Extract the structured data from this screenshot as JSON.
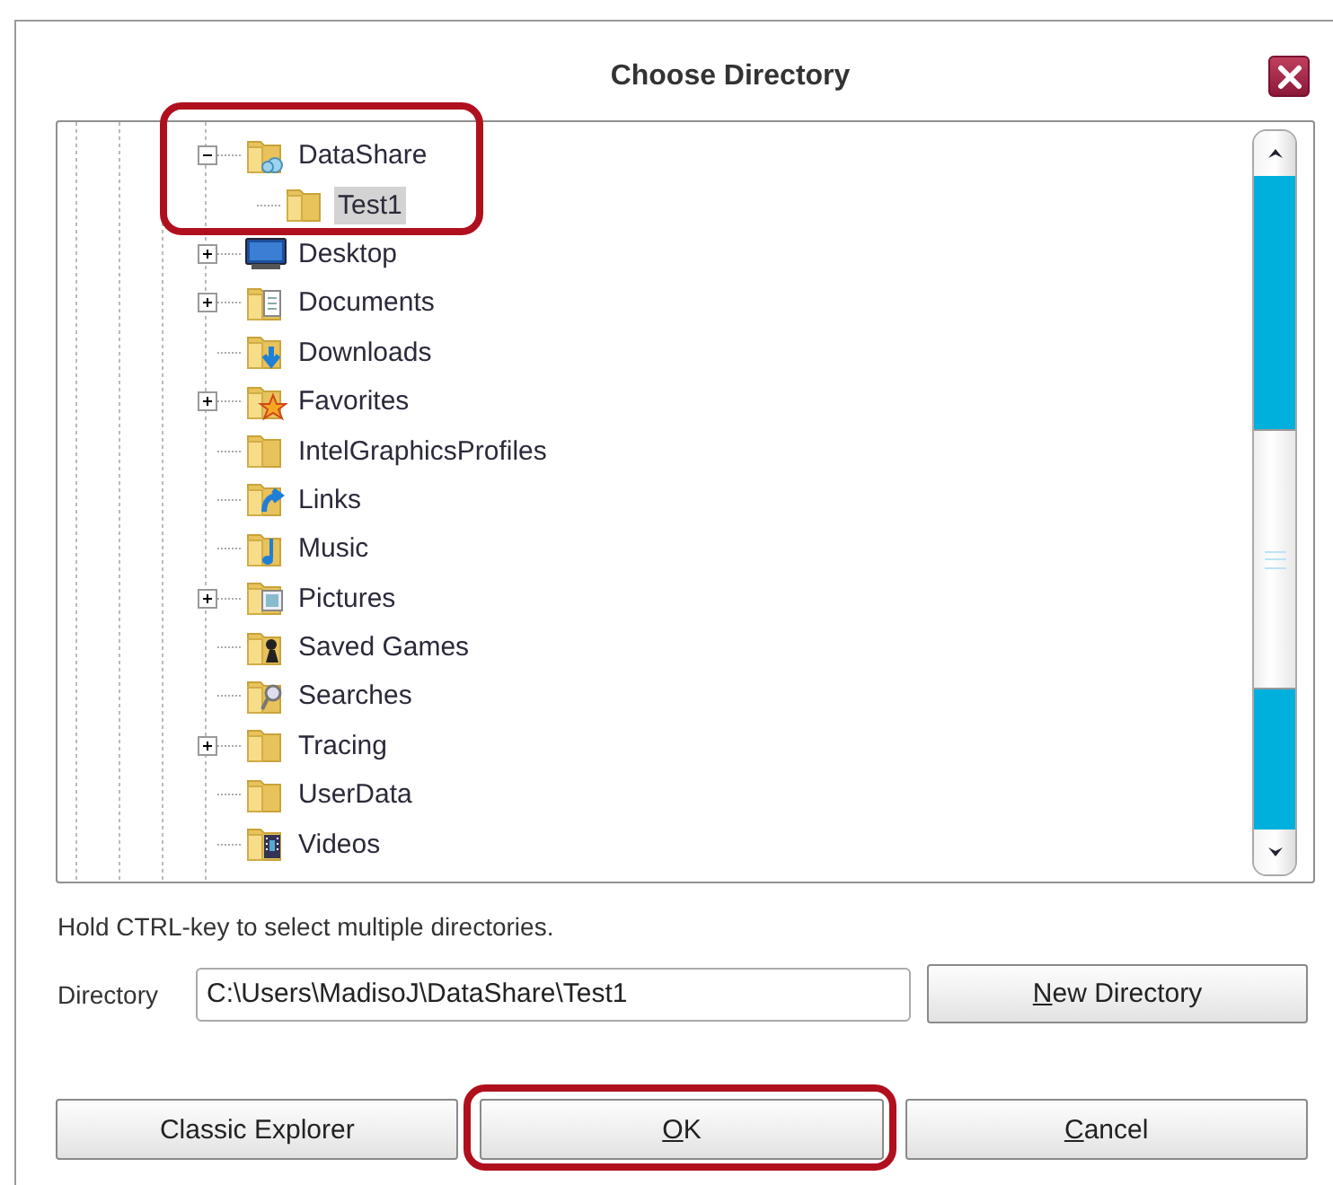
{
  "window": {
    "title": "Choose Directory"
  },
  "tree": [
    {
      "label": "DataShare",
      "kind": "cloud-folder",
      "expanded": true,
      "selected": false,
      "callout": true,
      "children": [
        {
          "label": "Test1",
          "kind": "folder",
          "selected": true
        }
      ]
    },
    {
      "label": "Desktop",
      "kind": "desktop",
      "expanded": false,
      "selected": false
    },
    {
      "label": "Documents",
      "kind": "documents",
      "expanded": false,
      "selected": false
    },
    {
      "label": "Downloads",
      "kind": "downloads",
      "selected": false
    },
    {
      "label": "Favorites",
      "kind": "favorites",
      "expanded": false,
      "selected": false
    },
    {
      "label": "IntelGraphicsProfiles",
      "kind": "folder",
      "selected": false
    },
    {
      "label": "Links",
      "kind": "links",
      "selected": false
    },
    {
      "label": "Music",
      "kind": "music",
      "selected": false
    },
    {
      "label": "Pictures",
      "kind": "pictures",
      "expanded": false,
      "selected": false
    },
    {
      "label": "Saved Games",
      "kind": "games",
      "selected": false
    },
    {
      "label": "Searches",
      "kind": "searches",
      "selected": false
    },
    {
      "label": "Tracing",
      "kind": "folder",
      "expanded": false,
      "selected": false
    },
    {
      "label": "UserData",
      "kind": "folder",
      "selected": false
    },
    {
      "label": "Videos",
      "kind": "videos",
      "selected": false
    }
  ],
  "hint": "Hold CTRL-key to select multiple directories.",
  "directory": {
    "label": "Directory",
    "value": "C:\\Users\\MadisoJ\\DataShare\\Test1"
  },
  "new_directory_button": {
    "label": "New Directory",
    "mnemonic": true
  },
  "buttons": [
    {
      "label": "Classic Explorer",
      "mnemonic": false,
      "callout": false
    },
    {
      "label": "OK",
      "mnemonic": true,
      "callout": true
    },
    {
      "label": "Cancel",
      "mnemonic": true,
      "callout": false
    }
  ]
}
